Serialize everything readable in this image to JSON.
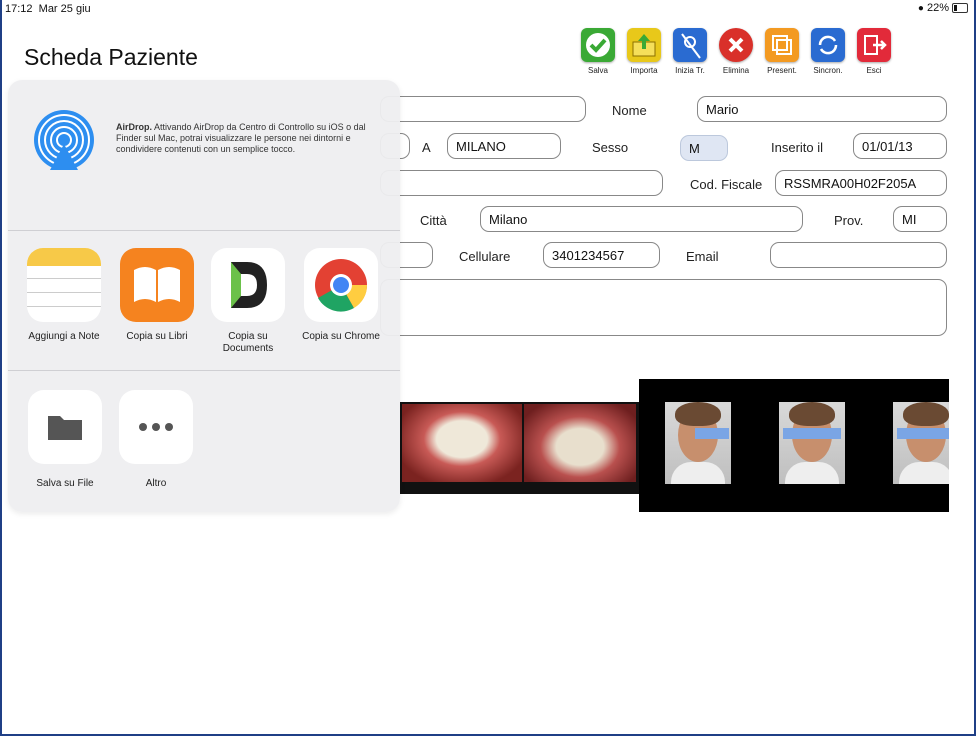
{
  "status": {
    "time": "17:12",
    "date": "Mar 25 giu",
    "battery": "22%"
  },
  "title": "Scheda Paziente",
  "toolbar": [
    {
      "label": "Salva",
      "color": "#3aa935"
    },
    {
      "label": "Importa",
      "color": "#e8c81a"
    },
    {
      "label": "Inizia Tr.",
      "color": "#2a6bd1"
    },
    {
      "label": "Elimina",
      "color": "#d9302a"
    },
    {
      "label": "Present.",
      "color": "#f39a22"
    },
    {
      "label": "Sincron.",
      "color": "#2a6bd1"
    },
    {
      "label": "Esci",
      "color": "#e22a3a"
    }
  ],
  "form": {
    "nome_label": "Nome",
    "nome": "Mario",
    "a_label": "A",
    "a": "MILANO",
    "sesso_label": "Sesso",
    "sesso": "M",
    "inserito_label": "Inserito il",
    "inserito": "01/01/13",
    "codfiscale_label": "Cod. Fiscale",
    "codfiscale": "RSSMRA00H02F205A",
    "citta_label": "Città",
    "citta": "Milano",
    "prov_label": "Prov.",
    "prov": "MI",
    "cellulare_label": "Cellulare",
    "cellulare": "3401234567",
    "email_label": "Email",
    "email": ""
  },
  "share": {
    "airdrop_title": "AirDrop.",
    "airdrop_text": "Attivando AirDrop da Centro di Controllo su iOS o dal Finder sul Mac, potrai visualizzare le persone nei dintorni e condividere contenuti con un semplice tocco.",
    "apps": [
      {
        "label": "Aggiungi a Note",
        "icon": "notes-icon"
      },
      {
        "label": "Copia su Libri",
        "icon": "books-icon"
      },
      {
        "label": "Copia su Documents",
        "icon": "documents-icon"
      },
      {
        "label": "Copia su Chrome",
        "icon": "chrome-icon"
      }
    ],
    "actions": [
      {
        "label": "Salva su File",
        "icon": "folder-icon"
      },
      {
        "label": "Altro",
        "icon": "more-icon"
      }
    ]
  }
}
